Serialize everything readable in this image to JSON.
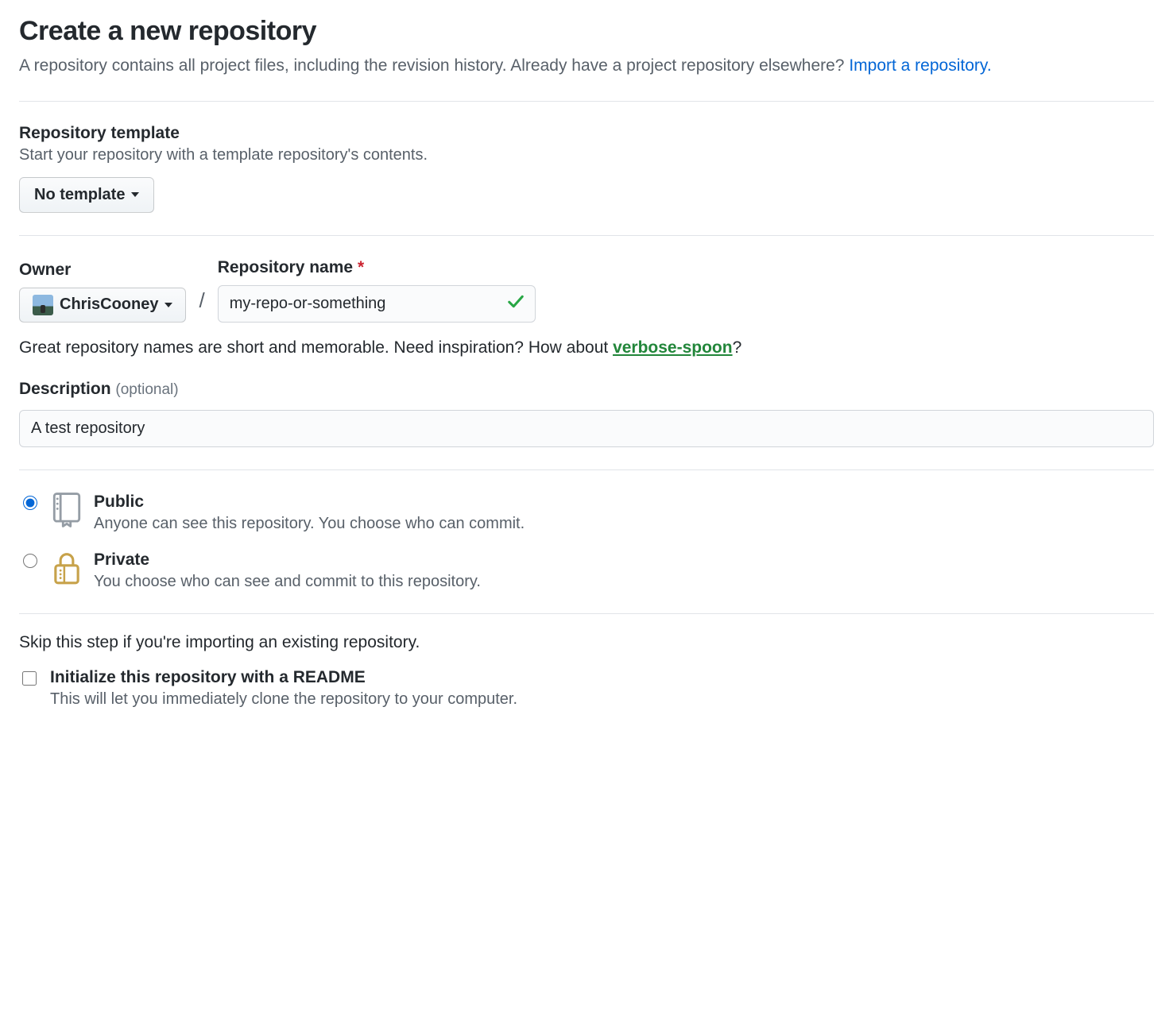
{
  "header": {
    "title": "Create a new repository",
    "subhead_before": "A repository contains all project files, including the revision history. Already have a project repository elsewhere? ",
    "import_link": "Import a repository."
  },
  "template": {
    "label": "Repository template",
    "help": "Start your repository with a template repository's contents.",
    "selected": "No template"
  },
  "owner": {
    "label": "Owner",
    "name": "ChrisCooney"
  },
  "repo": {
    "label": "Repository name",
    "value": "my-repo-or-something",
    "hint_before": "Great repository names are short and memorable. Need inspiration? How about ",
    "suggestion": "verbose-spoon",
    "hint_after": "?"
  },
  "description": {
    "label": "Description",
    "optional": "(optional)",
    "value": "A test repository"
  },
  "visibility": {
    "public": {
      "title": "Public",
      "desc": "Anyone can see this repository. You choose who can commit."
    },
    "private": {
      "title": "Private",
      "desc": "You choose who can see and commit to this repository."
    }
  },
  "init": {
    "skip_note": "Skip this step if you're importing an existing repository.",
    "readme_title": "Initialize this repository with a README",
    "readme_desc": "This will let you immediately clone the repository to your computer."
  }
}
